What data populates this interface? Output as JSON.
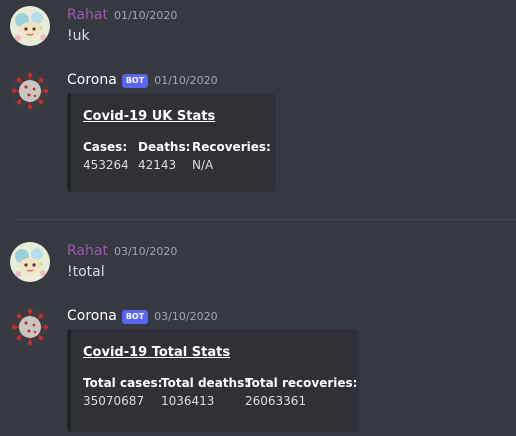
{
  "messages": [
    {
      "author": "Rahat",
      "timestamp": "01/10/2020",
      "text": "!uk"
    },
    {
      "author": "Corona",
      "bot_tag": "BOT",
      "timestamp": "01/10/2020",
      "embed": {
        "title": "Covid-19 UK Stats",
        "fields": [
          {
            "name": "Cases:",
            "value": "453264"
          },
          {
            "name": "Deaths:",
            "value": "42143"
          },
          {
            "name": "Recoveries:",
            "value": "N/A"
          }
        ]
      }
    },
    {
      "author": "Rahat",
      "timestamp": "03/10/2020",
      "text": "!total"
    },
    {
      "author": "Corona",
      "bot_tag": "BOT",
      "timestamp": "03/10/2020",
      "embed": {
        "title": "Covid-19 Total Stats",
        "fields": [
          {
            "name": "Total cases:",
            "value": "35070687"
          },
          {
            "name": "Total deaths:",
            "value": "1036413"
          },
          {
            "name": "Total recoveries:",
            "value": "26063361"
          }
        ]
      }
    }
  ],
  "colors": {
    "background": "#36393f",
    "embed_background": "#2f3136",
    "user_name": "#9b59b6",
    "bot_tag": "#5865f2",
    "timestamp": "#a3a6aa"
  },
  "icons": {
    "user_avatar": "cartoon-avatar-icon",
    "bot_avatar": "coronavirus-icon"
  }
}
